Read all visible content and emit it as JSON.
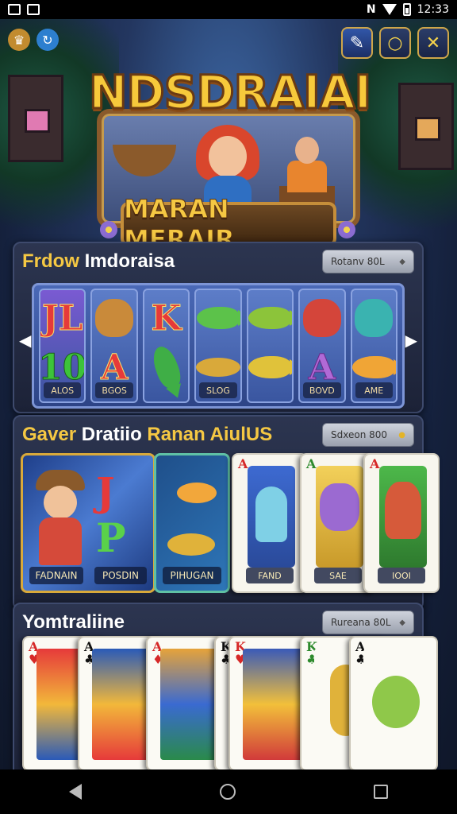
{
  "status_bar": {
    "time": "12:33",
    "carrier_icon": "N"
  },
  "header": {
    "title": "NDSDRAIAI",
    "subtitle": "MARAN MERAIR",
    "icons": [
      "trophy-icon",
      "refresh-icon",
      "pencil-icon",
      "circle-icon",
      "close-icon"
    ],
    "accent": "#f7c93b"
  },
  "section1": {
    "title_part1": "Frdow",
    "title_part2": "Imdoraisa",
    "filter_label": "Rotanv 80L",
    "reels": [
      {
        "top": "JL",
        "mid": "10",
        "label": "ALOS"
      },
      {
        "top": "",
        "mid": "A",
        "label": "BGOS"
      },
      {
        "top": "K",
        "mid": "",
        "label": ""
      },
      {
        "top": "",
        "mid": "",
        "label": "SLOG"
      },
      {
        "top": "",
        "mid": "",
        "label": ""
      },
      {
        "top": "",
        "mid": "A",
        "label": "BOVD"
      },
      {
        "top": "",
        "mid": "",
        "label": "AME"
      }
    ]
  },
  "section2": {
    "title_part1": "Gaver",
    "title_part2": "Dratiio",
    "title_part3": "Ranan AiulUS",
    "filter_label": "Sdxeon 800",
    "cards": [
      {
        "caption": "FADNAIN"
      },
      {
        "caption": "POSDIN",
        "symbol_top": "J",
        "symbol_bottom": "P"
      },
      {
        "caption": "PIHUGAN"
      },
      {
        "caption": "FAND",
        "corner": "A"
      },
      {
        "caption": "SAE",
        "corner": "A"
      },
      {
        "caption": "IOOI",
        "corner": "A"
      }
    ]
  },
  "section3": {
    "title": "Yomtraliine",
    "filter_label": "Rureana 80L",
    "cards": [
      {
        "rank": "A",
        "suit": "♥"
      },
      {
        "rank": "A",
        "suit": "♣"
      },
      {
        "rank": "A",
        "suit": "♦"
      },
      {
        "rank": "K",
        "suit": "♣"
      },
      {
        "rank": "K",
        "suit": "♥"
      },
      {
        "rank": "K",
        "suit": "♣"
      },
      {
        "rank": "A",
        "suit": "♣"
      }
    ]
  }
}
